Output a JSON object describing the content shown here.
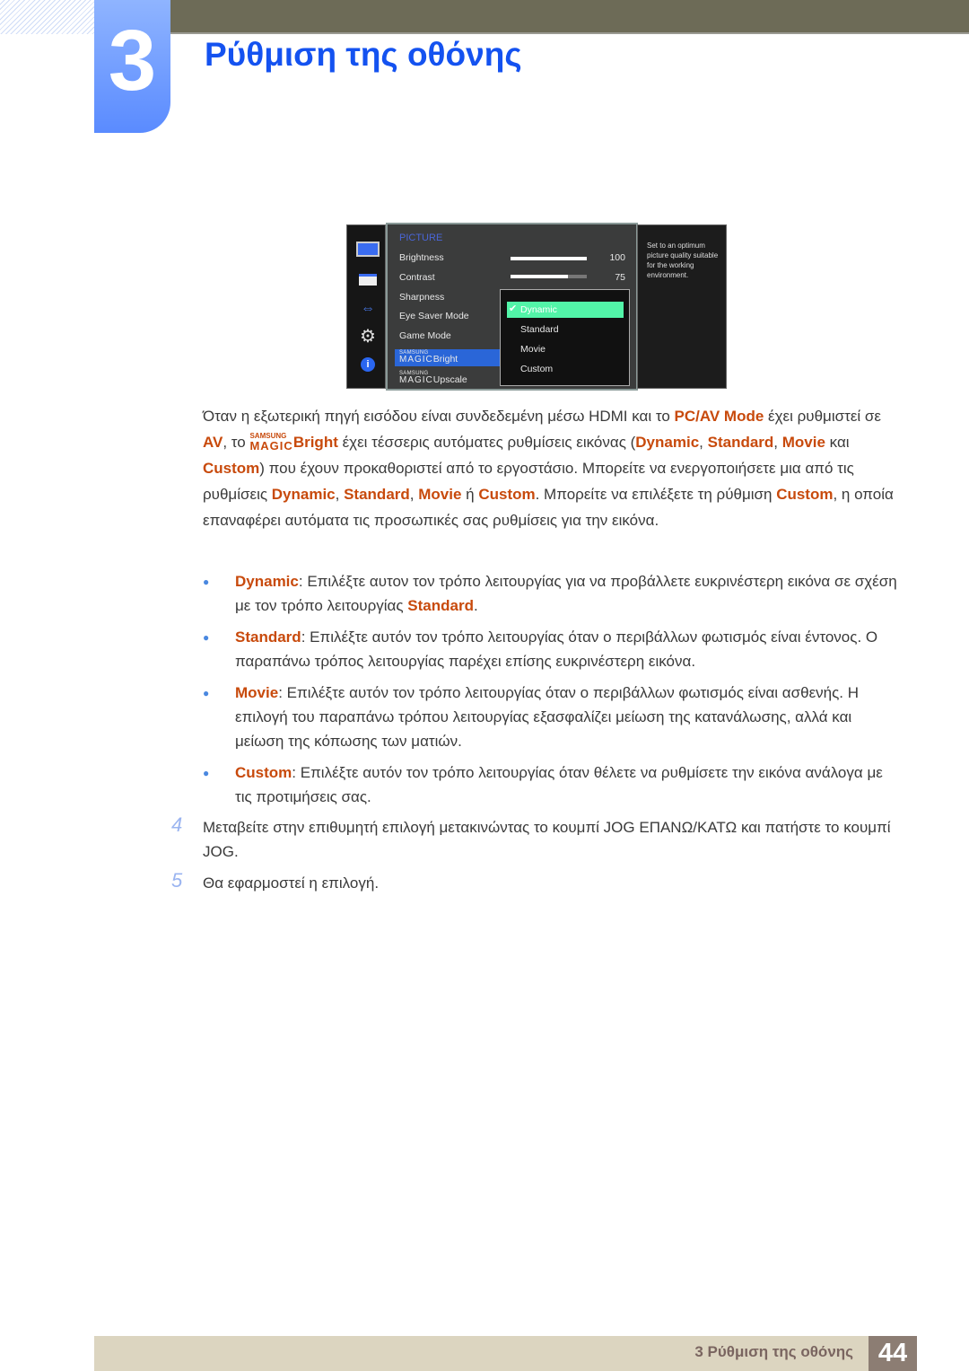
{
  "header": {
    "chapter_number": "3",
    "title": "Ρύθμιση της οθόνης"
  },
  "osd": {
    "section": "PICTURE",
    "items": [
      {
        "label": "Brightness",
        "value": "100",
        "level": 100
      },
      {
        "label": "Contrast",
        "value": "75",
        "level": 75
      },
      {
        "label": "Sharpness"
      },
      {
        "label": "Eye Saver Mode"
      },
      {
        "label": "Game Mode"
      }
    ],
    "magic_small": "SAMSUNG",
    "magic_big": "MAGIC",
    "magic_bright": "Bright",
    "magic_upscale": "Upscale",
    "options": [
      "Dynamic",
      "Standard",
      "Movie",
      "Custom"
    ],
    "selected_option": "Dynamic",
    "help": "Set to an optimum picture quality suitable for the working environment.",
    "icons": [
      "monitor-icon",
      "osd-settings-icon",
      "size-position-icon",
      "gear-icon",
      "info-icon"
    ],
    "colors": {
      "highlight": "#52f4a8",
      "selected": "#2a66d8",
      "section": "#4a66d8"
    }
  },
  "intro": [
    {
      "t": "Όταν η εξωτερική πηγή εισόδου είναι συνδεδεμένη μέσω HDMI και το "
    },
    {
      "t": "PC/AV Mode",
      "b": 1
    },
    {
      "t": " έχει ρυθμιστεί σε "
    },
    {
      "t": "AV",
      "b": 1
    },
    {
      "t": ", το "
    },
    {
      "magic": 1,
      "s": "SAMSUNG",
      "m": "MAGIC"
    },
    {
      "t": "Bright",
      "b": 1
    },
    {
      "t": " έχει τέσσερις αυτόματες ρυθμίσεις εικόνας ("
    },
    {
      "t": "Dynamic",
      "b": 1
    },
    {
      "t": ", "
    },
    {
      "t": "Standard",
      "b": 1
    },
    {
      "t": ", "
    },
    {
      "t": "Movie",
      "b": 1
    },
    {
      "t": " και "
    },
    {
      "t": "Custom",
      "b": 1
    },
    {
      "t": ") που έχουν προκαθοριστεί από το εργοστάσιο. Μπορείτε να ενεργοποιήσετε μια από τις ρυθμίσεις "
    },
    {
      "t": "Dynamic",
      "b": 1
    },
    {
      "t": ", "
    },
    {
      "t": "Standard",
      "b": 1
    },
    {
      "t": ", "
    },
    {
      "t": "Movie",
      "b": 1
    },
    {
      "t": " ή "
    },
    {
      "t": "Custom",
      "b": 1
    },
    {
      "t": ". Μπορείτε να επιλέξετε τη ρύθμιση "
    },
    {
      "t": "Custom",
      "b": 1
    },
    {
      "t": ", η οποία επαναφέρει αυτόματα τις προσωπικές σας ρυθμίσεις για την εικόνα."
    }
  ],
  "bullets": [
    [
      {
        "t": "Dynamic",
        "b": 1
      },
      {
        "t": ": Επιλέξτε αυτον τον τρόπο λειτουργίας για να προβάλλετε ευκρινέστερη εικόνα σε σχέση με τον τρόπο λειτουργίας "
      },
      {
        "t": "Standard",
        "b": 1
      },
      {
        "t": "."
      }
    ],
    [
      {
        "t": "Standard",
        "b": 1
      },
      {
        "t": ": Επιλέξτε αυτόν τον τρόπο λειτουργίας όταν ο περιβάλλων φωτισμός είναι έντονος. Ο παραπάνω τρόπος λειτουργίας παρέχει επίσης ευκρινέστερη εικόνα."
      }
    ],
    [
      {
        "t": "Movie",
        "b": 1
      },
      {
        "t": ": Επιλέξτε αυτόν τον τρόπο λειτουργίας όταν ο περιβάλλων φωτισμός είναι ασθενής. Η επιλογή του παραπάνω τρόπου λειτουργίας εξασφαλίζει μείωση της κατανάλωσης, αλλά και μείωση της κόπωσης των ματιών."
      }
    ],
    [
      {
        "t": "Custom",
        "b": 1
      },
      {
        "t": ": Επιλέξτε αυτόν τον τρόπο λειτουργίας όταν θέλετε να ρυθμίσετε την εικόνα ανάλογα με τις προτιμήσεις σας."
      }
    ]
  ],
  "steps": [
    {
      "num": "4",
      "text": "Μεταβείτε στην επιθυμητή επιλογή μετακινώντας το κουμπί JOG ΕΠΑΝΩ/ΚΑΤΩ και πατήστε το κουμπί JOG."
    },
    {
      "num": "5",
      "text": "Θα εφαρμοστεί η επιλογή."
    }
  ],
  "footer": {
    "label": "3 Ρύθμιση της οθόνης",
    "page": "44"
  },
  "colors": {
    "accent": "#c84a0c",
    "title": "#1452f0",
    "footer_bg": "#dcd5c0",
    "page_box": "#8c7d73"
  }
}
